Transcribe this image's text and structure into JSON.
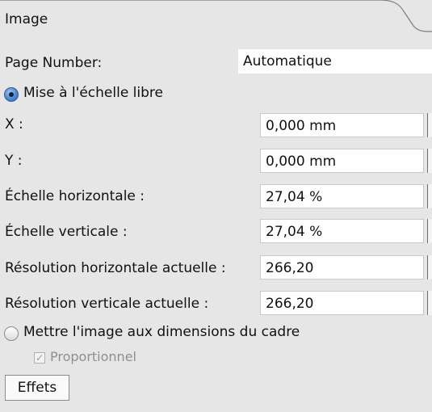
{
  "tab": {
    "title": "Image"
  },
  "page_number": {
    "label": "Page Number:",
    "value": "Automatiquе"
  },
  "free_scaling": {
    "label": "Mise à l'échelle libre",
    "selected": true
  },
  "fields": [
    {
      "label": "X :",
      "value": "0,000 mm"
    },
    {
      "label": "Y :",
      "value": "0,000 mm"
    },
    {
      "label": "Échelle horizontale :",
      "value": "27,04 %"
    },
    {
      "label": "Échelle verticale :",
      "value": "27,04 %"
    },
    {
      "label": "Résolution horizontale actuelle :",
      "value": "266,20"
    },
    {
      "label": "Résolution verticale actuelle :",
      "value": "266,20"
    }
  ],
  "fit_to_frame": {
    "label": "Mettre l'image aux dimensions du cadre",
    "selected": false
  },
  "proportional": {
    "label": "Proportionnel",
    "checked": true,
    "enabled": false
  },
  "effects_button": {
    "label": "Effets"
  }
}
